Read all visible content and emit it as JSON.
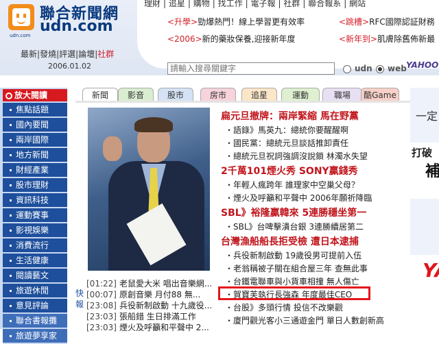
{
  "brand": {
    "name_cn": "聯合新聞網",
    "name_en": "udn.com",
    "logo_sub": "udn.com"
  },
  "top_nav": [
    "理財",
    "追星",
    "購物",
    "找工作",
    "電子報",
    "社群",
    "聯合報系",
    "網站"
  ],
  "promos": [
    {
      "tag": "<升學>",
      "text": "勁爆熱門！線上學習更有效率",
      "tag2": "<跳槽>",
      "text2": "RFC國際認証財務"
    },
    {
      "tag": "<2006>",
      "text": "新的藥妝保養,迎接新年度",
      "tag2": "<新年到>",
      "text2": "肌膚除舊佈新最"
    }
  ],
  "sub_nav": {
    "items": [
      "最新",
      "發燒",
      "評選",
      "論壇"
    ],
    "highlight": "社群"
  },
  "date": "2006.01.02",
  "search": {
    "placeholder": "請輸入搜尋關鍵字",
    "option_udn": "udn",
    "option_web": "web",
    "partner": "YAHOO!"
  },
  "sidebar": {
    "title": "放大閱讀",
    "items": [
      "焦點話題",
      "國內要聞",
      "兩岸國際",
      "地方新聞",
      "財經產業",
      "股市理財",
      "資訊科技",
      "運動賽事",
      "影視娛樂",
      "消費流行",
      "生活健康",
      "閱讀藝文",
      "旅遊休閒",
      "意見評論",
      "聯合書報攤",
      "旅遊夢享家"
    ]
  },
  "tabs": [
    {
      "label": "新聞",
      "color": "#ffffff"
    },
    {
      "label": "影音",
      "color": "#d9eed0"
    },
    {
      "label": "股市",
      "color": "#d5e2f5"
    },
    {
      "label": "房市",
      "color": "#f7d3dc"
    },
    {
      "label": "追星",
      "color": "#fbe6c8"
    },
    {
      "label": "運動",
      "color": "#dff0d0"
    },
    {
      "label": "職場",
      "color": "#e8e0f2"
    },
    {
      "label": "酷Game",
      "color": "#f7d0c8"
    }
  ],
  "headlines": [
    {
      "title": "扁元旦撤牌：兩岸緊縮 馬在野黨",
      "subs": [
        "・語錄》馬英九：總統你要醒醒啊",
        "・國民黨：總統元旦談話推卸責任",
        "・總統元旦祝詞強調沒說鎖 林濁水失望"
      ]
    },
    {
      "title": "2千萬101煙火秀 SONY贏錢秀",
      "subs": [
        "・年輕人瘋跨年 誰理家中空巢父母？",
        "・煙火及呼籲和平聲中 2006年願祈降臨"
      ]
    },
    {
      "title": "SBL》裕隆贏韓來 5連勝穩坐第一",
      "subs": [
        "・SBL》台啤擊潰台銀 3連勝續居第二"
      ]
    },
    {
      "title": "台灣漁船船長拒受檢 遭日本逮捕",
      "subs": [
        "・兵役新制啟動 19歲役男可提前入伍",
        "・老翁稱被子關在組合屋三年 查無此事",
        "・台鐵電聯車與小貨車相撞 無人傷亡",
        "・賀寶芙執行長強森 年度最佳CEO",
        "・台股》多頭行情 投信不改樂觀",
        "・廈門觀光客小三通遊金門 單日人數創新高"
      ]
    }
  ],
  "quick": {
    "label": "快報",
    "items": [
      {
        "time": "[01:22]",
        "text": "老鼠愛大米 唱出音樂網..."
      },
      {
        "time": "[00:07]",
        "text": "原創音樂 月付88 無..."
      },
      {
        "time": "[23:08]",
        "text": "兵役新制啟動 十九歲役..."
      },
      {
        "time": "[23:03]",
        "text": "張船錯 生日排滿工作"
      },
      {
        "time": "[23:03]",
        "text": "煙火及呼籲和平聲中 2..."
      }
    ]
  },
  "right_strip": {
    "text1": "一定",
    "text2": "打破",
    "text3": "補",
    "text4": "YA"
  }
}
